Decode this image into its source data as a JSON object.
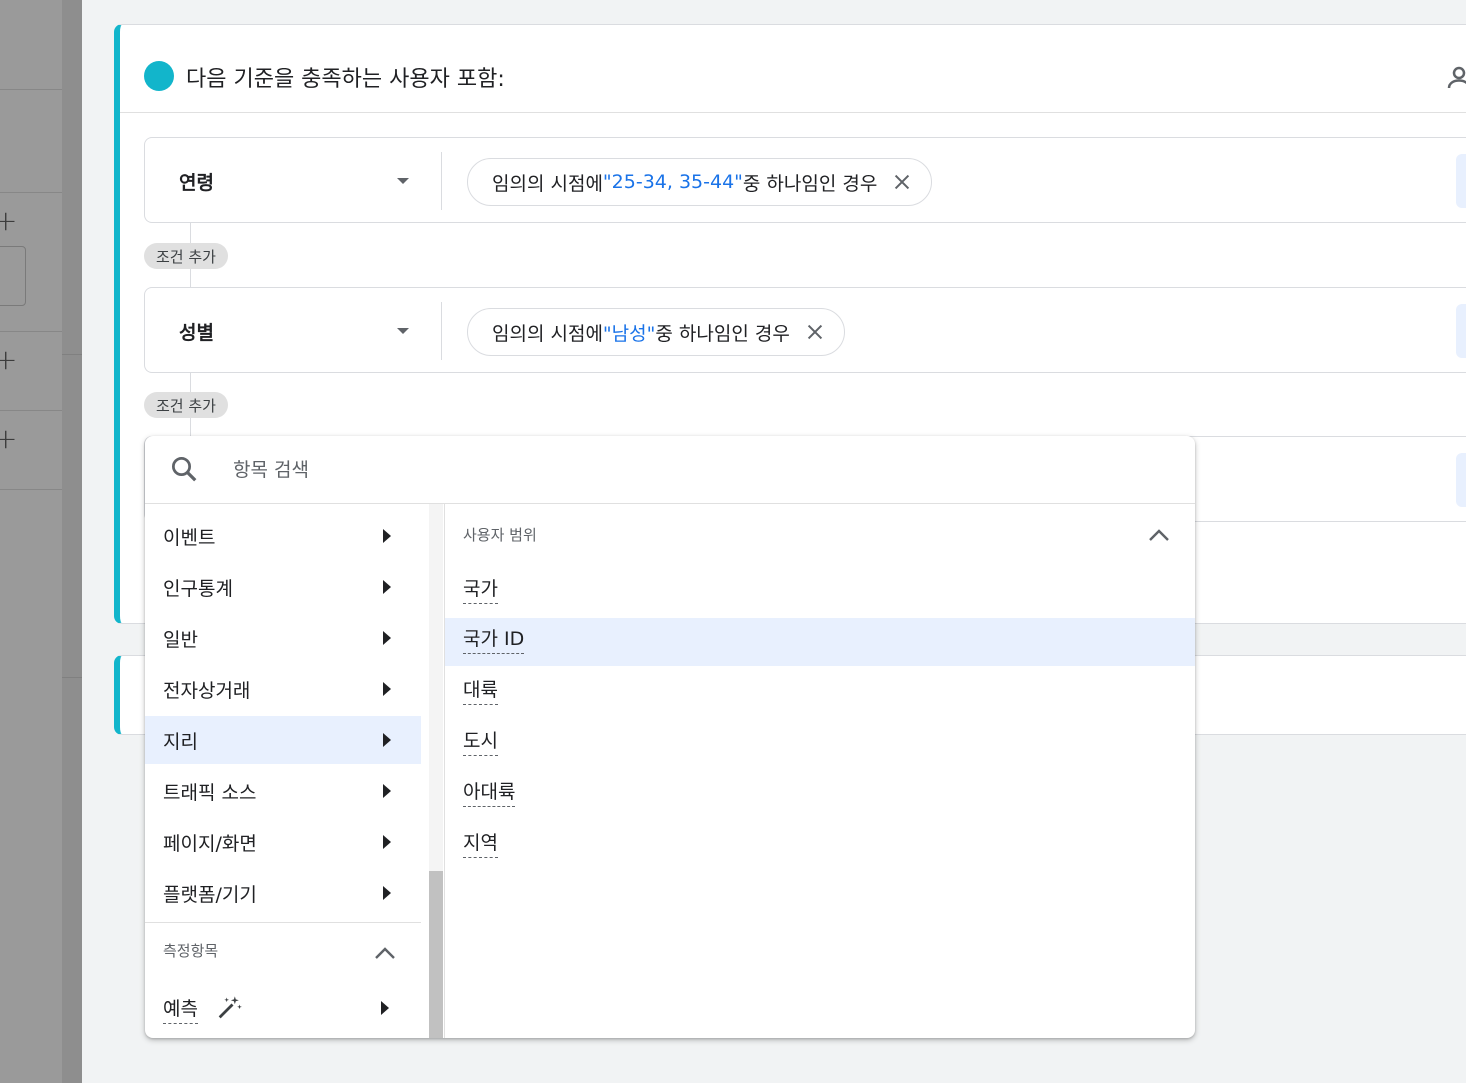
{
  "segment": {
    "title": "다음 기준을 충족하는 사용자 포함:",
    "conditions": [
      {
        "label": "연령",
        "chip_prefix": "임의의 시점에 ",
        "chip_value": "\"25-34, 35-44\"",
        "chip_suffix": " 중 하나임인 경우"
      },
      {
        "label": "성별",
        "chip_prefix": "임의의 시점에 ",
        "chip_value": "\"남성\"",
        "chip_suffix": " 중 하나임인 경우"
      }
    ],
    "add_condition_label": "조건 추가"
  },
  "menu": {
    "search_placeholder": "항목 검색",
    "categories": [
      {
        "label": "이벤트"
      },
      {
        "label": "인구통계"
      },
      {
        "label": "일반"
      },
      {
        "label": "전자상거래"
      },
      {
        "label": "지리"
      },
      {
        "label": "트래픽 소스"
      },
      {
        "label": "페이지/화면"
      },
      {
        "label": "플랫폼/기기"
      }
    ],
    "selected_category": "지리",
    "metrics_header": "측정항목",
    "predict_label": "예측",
    "right_header": "사용자 범위",
    "items": [
      {
        "label": "국가"
      },
      {
        "label": "국가 ID"
      },
      {
        "label": "대륙"
      },
      {
        "label": "도시"
      },
      {
        "label": "아대륙"
      },
      {
        "label": "지역"
      }
    ],
    "highlighted_item": "국가 ID"
  },
  "colors": {
    "accent": "#12b5cb",
    "link": "#1a73e8",
    "selected_bg": "#e8f0fe"
  }
}
